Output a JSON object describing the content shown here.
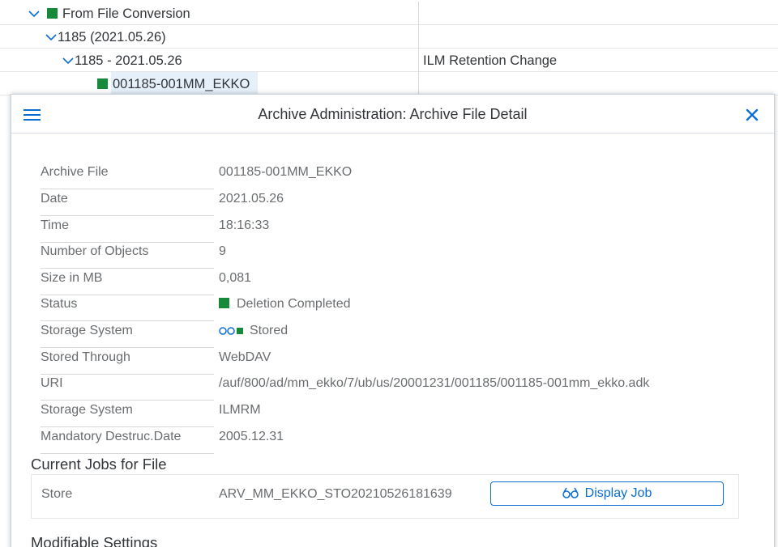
{
  "tree": {
    "rows": [
      {
        "label": "From File Conversion",
        "right": ""
      },
      {
        "label": "1185 (2021.05.26)",
        "right": ""
      },
      {
        "label": "1185 - 2021.05.26",
        "right": "ILM Retention Change"
      },
      {
        "label": "001185-001MM_EKKO",
        "right": ""
      }
    ]
  },
  "dialog": {
    "title": "Archive Administration: Archive File Detail",
    "menu_icon": "hamburger-icon",
    "close_icon": "close-icon",
    "fields": [
      {
        "label": "Archive File",
        "value": "001185-001MM_EKKO"
      },
      {
        "label": "Date",
        "value": "2021.05.26"
      },
      {
        "label": "Time",
        "value": "18:16:33"
      },
      {
        "label": "Number of Objects",
        "value": "9"
      },
      {
        "label": "Size in MB",
        "value": "0,081"
      },
      {
        "label": "Status",
        "value": "Deletion Completed"
      },
      {
        "label": "Storage System",
        "value": "Stored"
      },
      {
        "label": "Stored Through",
        "value": "WebDAV"
      },
      {
        "label": "URI",
        "value": "/auf/800/ad/mm_ekko/7/ub/us/20001231/001185/001185-001mm_ekko.adk"
      },
      {
        "label": "Storage System",
        "value": "ILMRM"
      },
      {
        "label": "Mandatory Destruc.Date",
        "value": "2005.12.31"
      }
    ],
    "jobs_section": {
      "title": "Current Jobs for File",
      "label": "Store",
      "value": "ARV_MM_EKKO_STO20210526181639",
      "button": "Display Job"
    },
    "modifiable_section": {
      "title": "Modifiable Settings"
    }
  },
  "colors": {
    "accent": "#0a6ed1",
    "status_green": "#16893b",
    "selection": "#e5f0fa"
  }
}
